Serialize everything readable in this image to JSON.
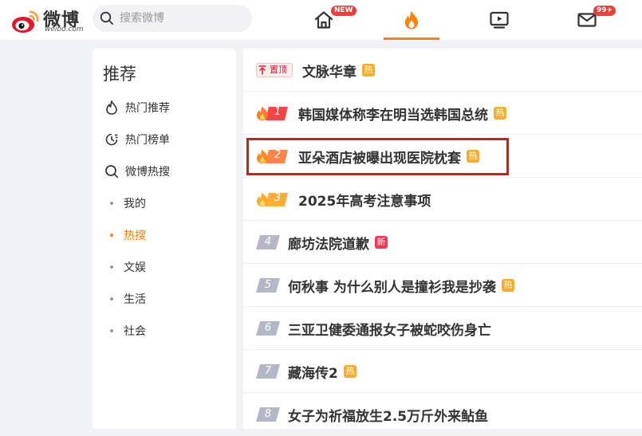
{
  "header": {
    "logo_text": "微博",
    "logo_sub": "weibo.com",
    "search_placeholder": "搜索微博",
    "nav": [
      {
        "name": "home",
        "badge": "NEW"
      },
      {
        "name": "hot",
        "active": true
      },
      {
        "name": "video"
      },
      {
        "name": "messages",
        "badge": "99+"
      }
    ],
    "accent_color": "#ff8200"
  },
  "sidebar": {
    "title": "推荐",
    "items": [
      {
        "label": "热门推荐",
        "icon": "flame-outline-icon"
      },
      {
        "label": "热门榜单",
        "icon": "clock-list-icon"
      },
      {
        "label": "微博热搜",
        "icon": "search-icon"
      }
    ],
    "subitems": [
      {
        "label": "我的"
      },
      {
        "label": "热搜",
        "active": true
      },
      {
        "label": "文娱"
      },
      {
        "label": "生活"
      },
      {
        "label": "社会"
      }
    ]
  },
  "hot_list": {
    "pinned": {
      "badge": "置顶",
      "title": "文脉华章",
      "tag": "热"
    },
    "items": [
      {
        "rank": "1",
        "title": "韩国媒体称李在明当选韩国总统",
        "tag": "热",
        "tag_type": "hot"
      },
      {
        "rank": "2",
        "title": "亚朵酒店被曝出现医院枕套",
        "tag": "热",
        "tag_type": "hot"
      },
      {
        "rank": "3",
        "title": "2025年高考注意事项",
        "tag": "",
        "tag_type": ""
      },
      {
        "rank": "4",
        "title": "廊坊法院道歉",
        "tag": "新",
        "tag_type": "new"
      },
      {
        "rank": "5",
        "title": "何秋事 为什么别人是撞衫我是抄袭",
        "tag": "热",
        "tag_type": "hot"
      },
      {
        "rank": "6",
        "title": "三亚卫健委通报女子被蛇咬伤身亡",
        "tag": "",
        "tag_type": ""
      },
      {
        "rank": "7",
        "title": "藏海传2",
        "tag": "热",
        "tag_type": "hot"
      },
      {
        "rank": "8",
        "title": "女子为祈福放生2.5万斤外来鲇鱼",
        "tag": "",
        "tag_type": ""
      }
    ],
    "colors": {
      "hot_tag": "#ffab2d",
      "new_tag": "#ff3852",
      "rank1": "#f54545",
      "rank2": "#ff8547",
      "rank3": "#ffac38",
      "rank_gray": "#b3b8c4"
    }
  }
}
